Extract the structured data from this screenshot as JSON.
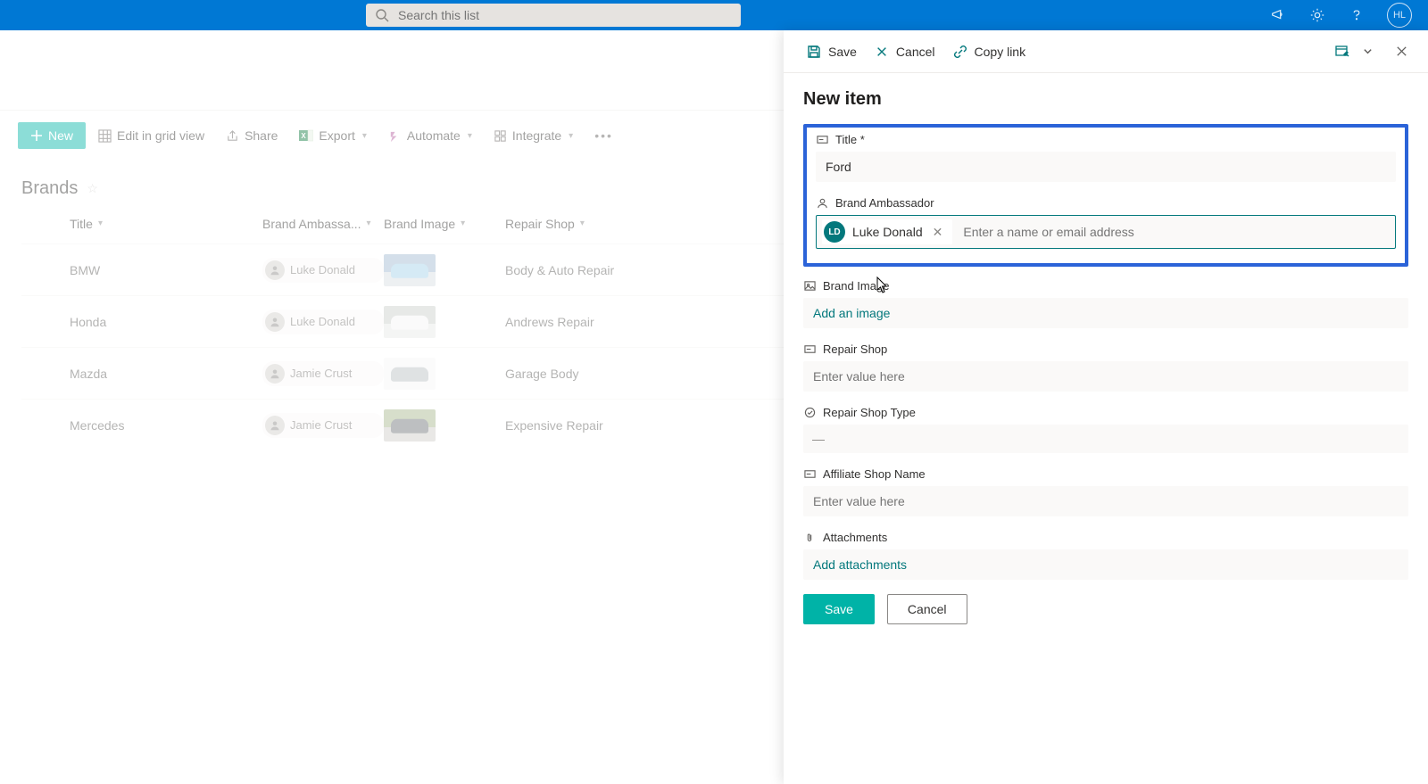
{
  "topbar": {
    "search_placeholder": "Search this list",
    "user_initials": "HL"
  },
  "commandbar": {
    "new": "New",
    "edit_grid": "Edit in grid view",
    "share": "Share",
    "export": "Export",
    "automate": "Automate",
    "integrate": "Integrate"
  },
  "list": {
    "title": "Brands",
    "columns": {
      "title": "Title",
      "brand_ambassador": "Brand Ambassa...",
      "brand_image": "Brand Image",
      "repair_shop": "Repair Shop"
    },
    "rows": [
      {
        "title": "BMW",
        "ambassador": "Luke Donald",
        "repair_shop": "Body & Auto Repair"
      },
      {
        "title": "Honda",
        "ambassador": "Luke Donald",
        "repair_shop": "Andrews Repair"
      },
      {
        "title": "Mazda",
        "ambassador": "Jamie Crust",
        "repair_shop": "Garage Body"
      },
      {
        "title": "Mercedes",
        "ambassador": "Jamie Crust",
        "repair_shop": "Expensive Repair"
      }
    ]
  },
  "panel": {
    "cmd_save": "Save",
    "cmd_cancel": "Cancel",
    "cmd_copylink": "Copy link",
    "title": "New item",
    "fields": {
      "title_label": "Title *",
      "title_value": "Ford",
      "ambassador_label": "Brand Ambassador",
      "ambassador_chip_initials": "LD",
      "ambassador_chip_name": "Luke Donald",
      "ambassador_placeholder": "Enter a name or email address",
      "brand_image_label": "Brand Image",
      "brand_image_action": "Add an image",
      "repair_shop_label": "Repair Shop",
      "repair_shop_placeholder": "Enter value here",
      "repair_shop_type_label": "Repair Shop Type",
      "repair_shop_type_value": "—",
      "affiliate_label": "Affiliate Shop Name",
      "affiliate_placeholder": "Enter value here",
      "attachments_label": "Attachments",
      "attachments_action": "Add attachments"
    },
    "save_btn": "Save",
    "cancel_btn": "Cancel"
  }
}
